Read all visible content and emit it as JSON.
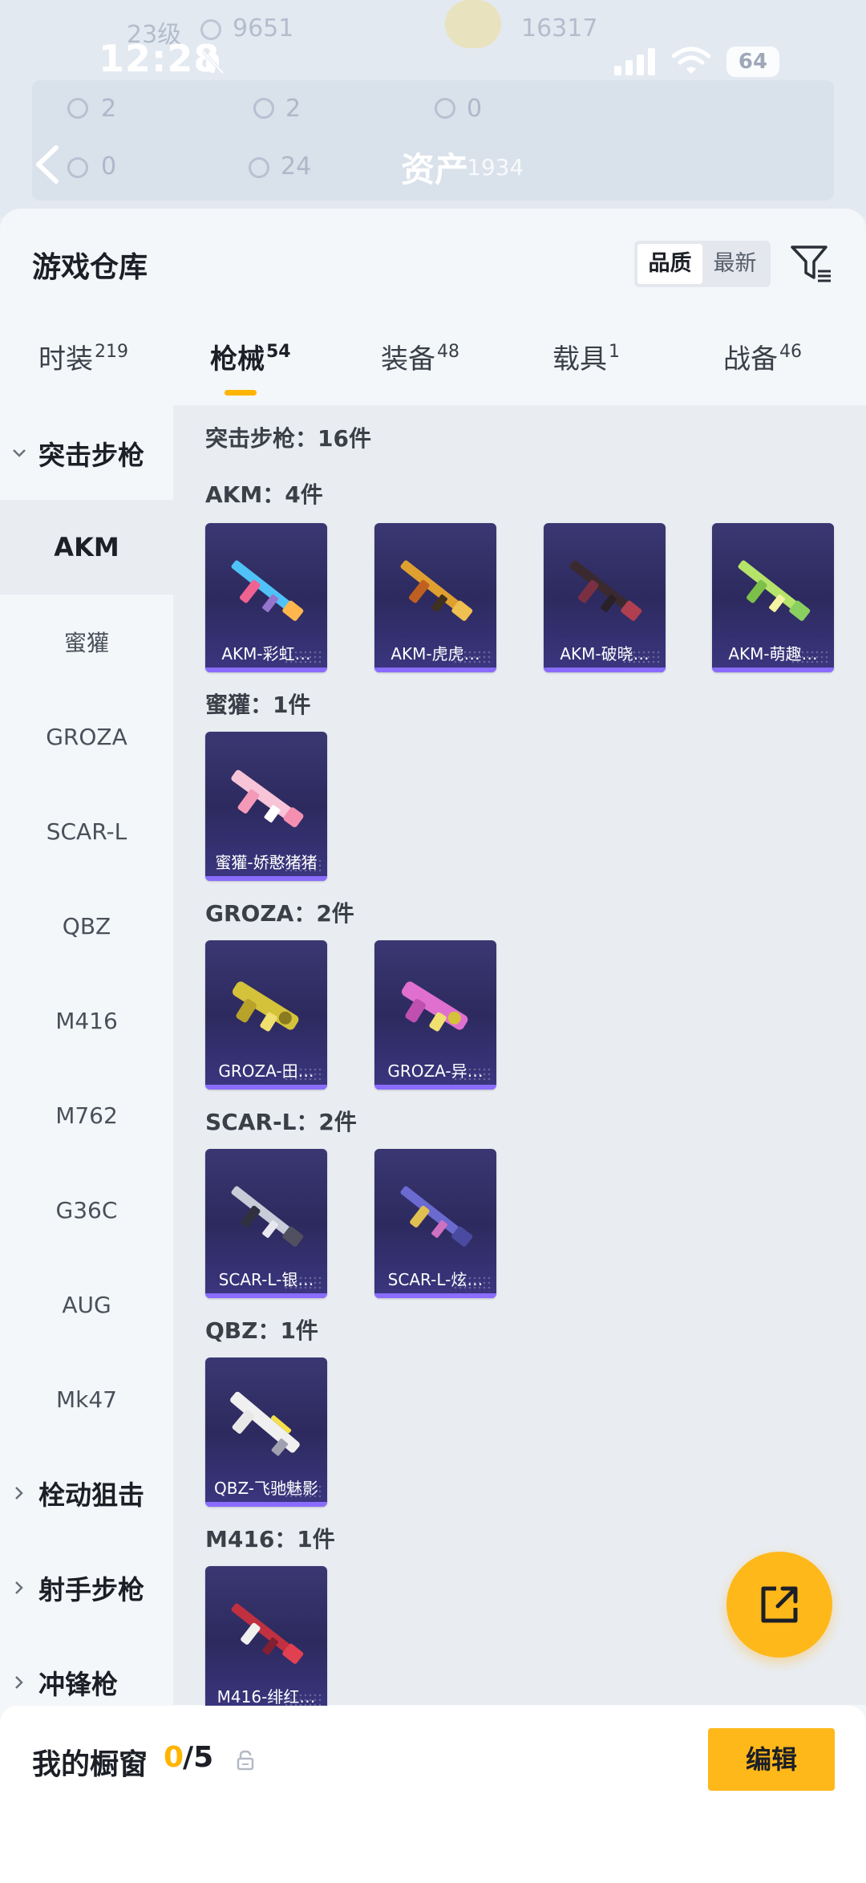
{
  "status_bar": {
    "time": "12:28",
    "battery": "64"
  },
  "background_header": {
    "level": "23级",
    "points": "9651",
    "score": "16317",
    "stats": [
      "2",
      "2",
      "0",
      "0",
      "24"
    ],
    "assets_label": "资产",
    "assets_value": "1934"
  },
  "sheet": {
    "title": "游戏仓库",
    "sort_options": [
      {
        "label": "品质",
        "active": true
      },
      {
        "label": "最新",
        "active": false
      }
    ]
  },
  "tabs": [
    {
      "label": "时装",
      "count": "219"
    },
    {
      "label": "枪械",
      "count": "54"
    },
    {
      "label": "装备",
      "count": "48"
    },
    {
      "label": "载具",
      "count": "1"
    },
    {
      "label": "战备",
      "count": "46"
    }
  ],
  "category_nav": {
    "open_group": "突击步枪",
    "items": [
      "AKM",
      "蜜獾",
      "GROZA",
      "SCAR-L",
      "QBZ",
      "M416",
      "M762",
      "G36C",
      "AUG",
      "Mk47"
    ],
    "closed_groups": [
      "栓动狙击",
      "射手步枪",
      "冲锋枪"
    ]
  },
  "content": {
    "summary": "突击步枪：16件",
    "sections": [
      {
        "label": "AKM：4件",
        "items": [
          "AKM-彩虹…",
          "AKM-虎虎…",
          "AKM-破晓…",
          "AKM-萌趣…"
        ]
      },
      {
        "label": "蜜獾：1件",
        "items": [
          "蜜獾-娇憨猪猪"
        ]
      },
      {
        "label": "GROZA：2件",
        "items": [
          "GROZA-田…",
          "GROZA-异…"
        ]
      },
      {
        "label": "SCAR-L：2件",
        "items": [
          "SCAR-L-银…",
          "SCAR-L-炫…"
        ]
      },
      {
        "label": "QBZ：1件",
        "items": [
          "QBZ-飞驰魅影"
        ]
      },
      {
        "label": "M416：1件",
        "items": [
          "M416-绯红…"
        ]
      }
    ]
  },
  "bottom_bar": {
    "showcase_label": "我的橱窗",
    "showcase_count": "0",
    "showcase_total": "/5",
    "edit_label": "编辑"
  },
  "colors": {
    "accent": "#ffb81a",
    "card_bg": "#2d2a5f",
    "card_strip": "#8a6cff",
    "sheet_bg": "#f4f7fa",
    "content_bg": "#e9edf2"
  },
  "icons": {
    "bell": "bell-muted-icon",
    "signal": "signal-icon",
    "wifi": "wifi-icon",
    "back": "back-arrow-icon",
    "filter": "filter-funnel-icon",
    "share": "share-external-icon",
    "lock": "lock-icon",
    "chevron_down": "chevron-down-icon",
    "chevron_right": "chevron-right-icon"
  }
}
